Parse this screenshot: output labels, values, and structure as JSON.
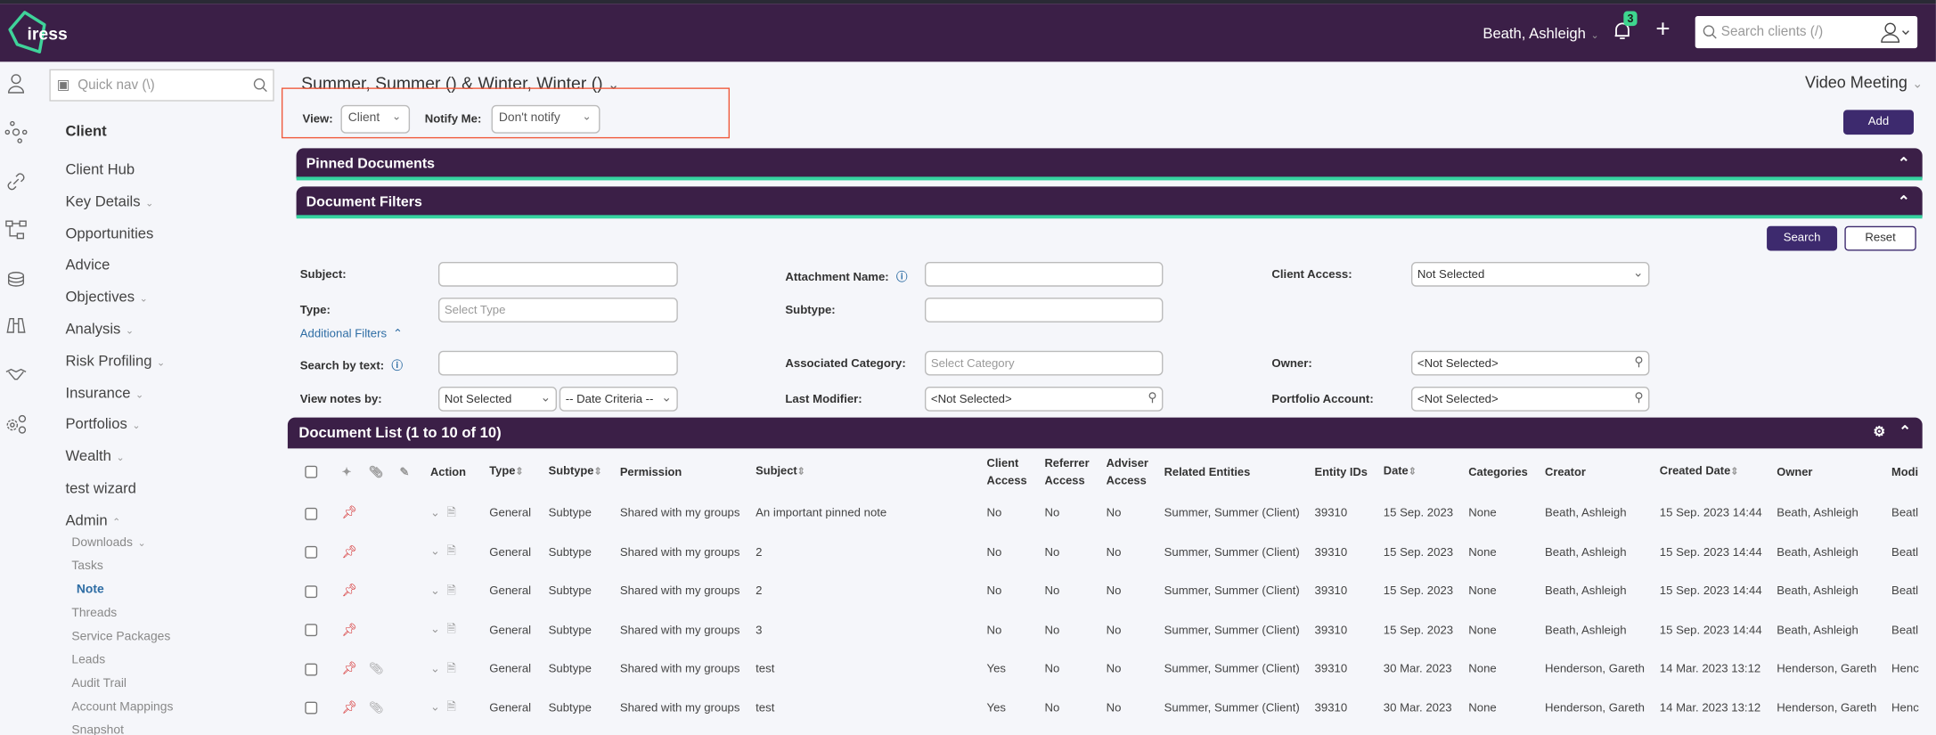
{
  "colors": {
    "brand": "#3b1f47",
    "accent": "#35d3a0",
    "primary_button": "#3d2a6e",
    "pin": "#d42a2a",
    "link": "#2e6da4",
    "highlight_box": "#f05a3c"
  },
  "header": {
    "logo": "iress",
    "user": "Beath, Ashleigh",
    "notifications": "3",
    "search_placeholder": "Search clients (/)"
  },
  "sidebar": {
    "quick_nav_placeholder": "Quick nav (\\)",
    "section": "Client",
    "items": [
      {
        "label": "Client Hub",
        "chevron": false
      },
      {
        "label": "Key Details",
        "chevron": true
      },
      {
        "label": "Opportunities",
        "chevron": false
      },
      {
        "label": "Advice",
        "chevron": false
      },
      {
        "label": "Objectives",
        "chevron": true
      },
      {
        "label": "Analysis",
        "chevron": true
      },
      {
        "label": "Risk Profiling",
        "chevron": true
      },
      {
        "label": "Insurance",
        "chevron": true
      },
      {
        "label": "Portfolios",
        "chevron": true
      },
      {
        "label": "Wealth",
        "chevron": true
      },
      {
        "label": "test wizard",
        "chevron": false
      },
      {
        "label": "Admin",
        "chevron": true
      }
    ],
    "admin_items": [
      "Downloads",
      "Tasks",
      "Note",
      "Threads",
      "Service Packages",
      "Leads",
      "Audit Trail",
      "Account Mappings",
      "Snapshot"
    ],
    "active": "Note",
    "icons": [
      "person-icon",
      "network-icon",
      "link-icon",
      "hierarchy-icon",
      "coins-icon",
      "binoculars-icon",
      "handshake-icon",
      "gears-icon"
    ]
  },
  "page": {
    "title": "Summer, Summer () & Winter, Winter ()",
    "video_meeting": "Video Meeting",
    "add": "Add",
    "view_label": "View:",
    "view_value": "Client",
    "notify_label": "Notify Me:",
    "notify_value": "Don't notify"
  },
  "panels": {
    "pinned": "Pinned Documents",
    "filters": "Document Filters"
  },
  "filters": {
    "search": "Search",
    "reset": "Reset",
    "subject": "Subject:",
    "attachment": "Attachment Name:",
    "client_access": "Client Access:",
    "client_access_value": "Not Selected",
    "type": "Type:",
    "type_placeholder": "Select Type",
    "subtype": "Subtype:",
    "additional": "Additional Filters",
    "search_text": "Search by text:",
    "assoc_category": "Associated Category:",
    "assoc_placeholder": "Select Category",
    "owner": "Owner:",
    "owner_value": "<Not Selected>",
    "view_notes": "View notes by:",
    "view_notes_value": "Not Selected",
    "date_criteria": "-- Date Criteria --",
    "last_modifier": "Last Modifier:",
    "last_modifier_value": "<Not Selected>",
    "portfolio": "Portfolio Account:",
    "portfolio_value": "<Not Selected>"
  },
  "list": {
    "title": "Document List (1 to 10 of 10)",
    "columns": [
      "Action",
      "Type",
      "Subtype",
      "Permission",
      "Subject",
      "Client Access",
      "Referrer Access",
      "Adviser Access",
      "Related Entities",
      "Entity IDs",
      "Date",
      "Categories",
      "Creator",
      "Created Date",
      "Owner",
      "Modi"
    ],
    "rows": [
      {
        "attachment": false,
        "type": "General",
        "subtype": "Subtype",
        "permission": "Shared with my groups",
        "subject": "An important pinned note",
        "client": "No",
        "referrer": "No",
        "adviser": "No",
        "related": "Summer, Summer (Client)",
        "entity": "39310",
        "date": "15 Sep. 2023",
        "categories": "None",
        "creator": "Beath, Ashleigh",
        "created": "15 Sep. 2023 14:44",
        "owner": "Beath, Ashleigh",
        "modifier": "Beatl"
      },
      {
        "attachment": false,
        "type": "General",
        "subtype": "Subtype",
        "permission": "Shared with my groups",
        "subject": "2",
        "client": "No",
        "referrer": "No",
        "adviser": "No",
        "related": "Summer, Summer (Client)",
        "entity": "39310",
        "date": "15 Sep. 2023",
        "categories": "None",
        "creator": "Beath, Ashleigh",
        "created": "15 Sep. 2023 14:44",
        "owner": "Beath, Ashleigh",
        "modifier": "Beatl"
      },
      {
        "attachment": false,
        "type": "General",
        "subtype": "Subtype",
        "permission": "Shared with my groups",
        "subject": "2",
        "client": "No",
        "referrer": "No",
        "adviser": "No",
        "related": "Summer, Summer (Client)",
        "entity": "39310",
        "date": "15 Sep. 2023",
        "categories": "None",
        "creator": "Beath, Ashleigh",
        "created": "15 Sep. 2023 14:44",
        "owner": "Beath, Ashleigh",
        "modifier": "Beatl"
      },
      {
        "attachment": false,
        "type": "General",
        "subtype": "Subtype",
        "permission": "Shared with my groups",
        "subject": "3",
        "client": "No",
        "referrer": "No",
        "adviser": "No",
        "related": "Summer, Summer (Client)",
        "entity": "39310",
        "date": "15 Sep. 2023",
        "categories": "None",
        "creator": "Beath, Ashleigh",
        "created": "15 Sep. 2023 14:44",
        "owner": "Beath, Ashleigh",
        "modifier": "Beatl"
      },
      {
        "attachment": true,
        "type": "General",
        "subtype": "Subtype",
        "permission": "Shared with my groups",
        "subject": "test",
        "client": "Yes",
        "referrer": "No",
        "adviser": "No",
        "related": "Summer, Summer (Client)",
        "entity": "39310",
        "date": "30 Mar. 2023",
        "categories": "None",
        "creator": "Henderson, Gareth",
        "created": "14 Mar. 2023 13:12",
        "owner": "Henderson, Gareth",
        "modifier": "Henc"
      },
      {
        "attachment": true,
        "type": "General",
        "subtype": "Subtype",
        "permission": "Shared with my groups",
        "subject": "test",
        "client": "Yes",
        "referrer": "No",
        "adviser": "No",
        "related": "Summer, Summer (Client)",
        "entity": "39310",
        "date": "30 Mar. 2023",
        "categories": "None",
        "creator": "Henderson, Gareth",
        "created": "14 Mar. 2023 13:12",
        "owner": "Henderson, Gareth",
        "modifier": "Henc"
      }
    ]
  }
}
